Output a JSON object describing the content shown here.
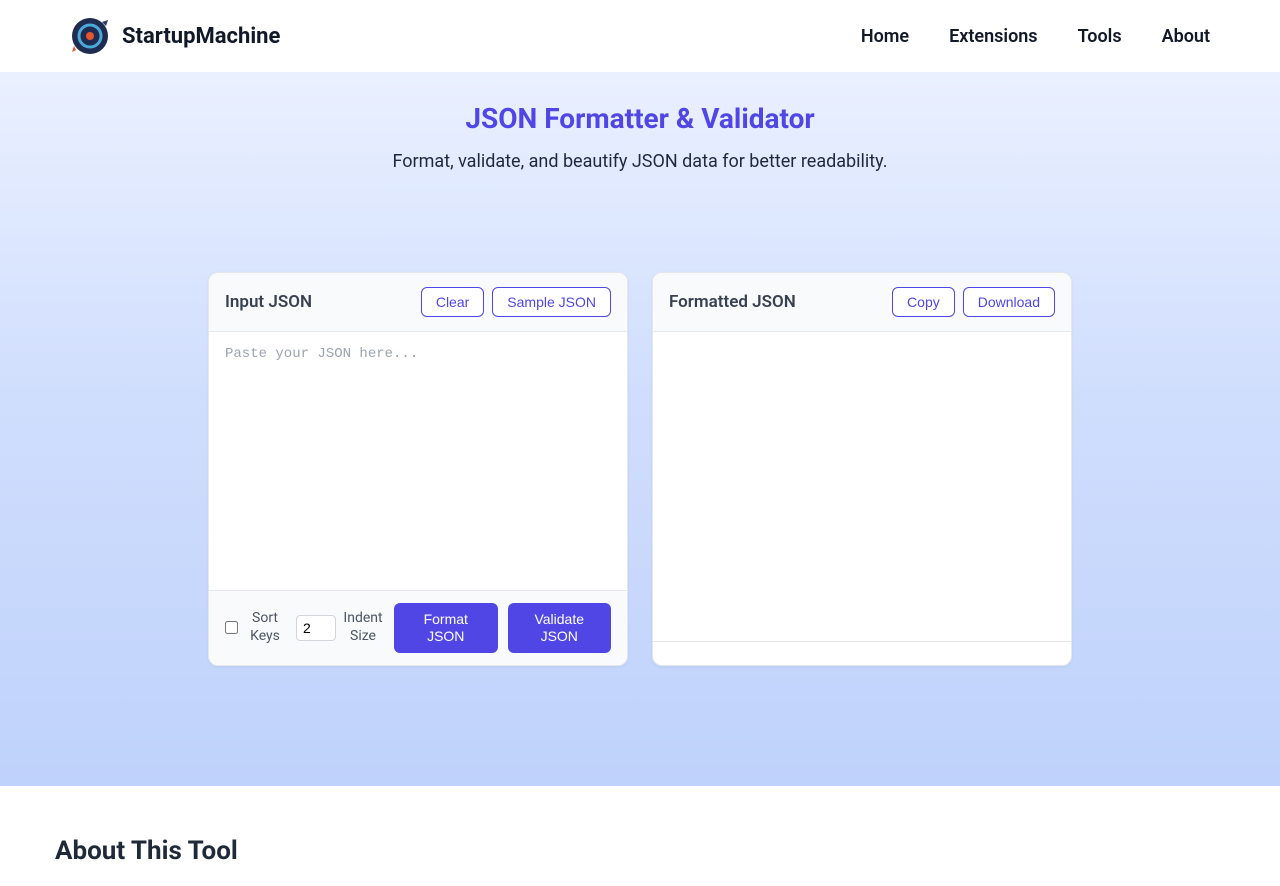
{
  "header": {
    "brand": "StartupMachine",
    "nav": [
      "Home",
      "Extensions",
      "Tools",
      "About"
    ]
  },
  "hero": {
    "title": "JSON Formatter & Validator",
    "subtitle": "Format, validate, and beautify JSON data for better readability."
  },
  "input_panel": {
    "title": "Input JSON",
    "clear": "Clear",
    "sample": "Sample JSON",
    "placeholder": "Paste your JSON here...",
    "sort_keys_label": "Sort Keys",
    "indent_label": "Indent Size",
    "indent_value": "2",
    "format_btn": "Format JSON",
    "validate_btn": "Validate JSON"
  },
  "output_panel": {
    "title": "Formatted JSON",
    "copy": "Copy",
    "download": "Download"
  },
  "about": {
    "title": "About This Tool"
  }
}
